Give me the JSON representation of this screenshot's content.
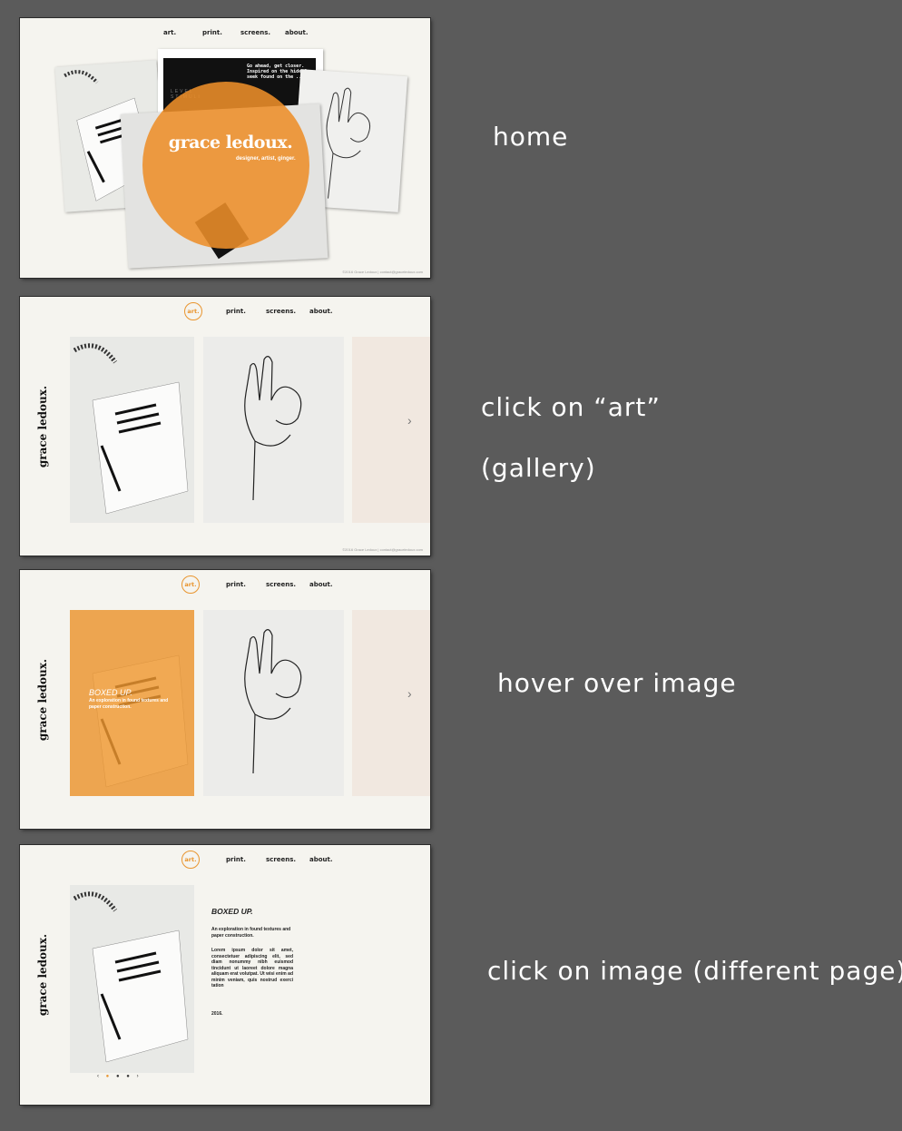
{
  "nav": {
    "art": "art.",
    "print": "print.",
    "screens": "screens.",
    "about": "about."
  },
  "site": {
    "brand": "grace ledoux.",
    "tagline": "designer, artist, ginger.",
    "footer": "©2016 Grace Ledoux | contact@graceledoux.com"
  },
  "home": {
    "card_text": "Go ahead, get closer. Inspired on the hide & seek found on the ...",
    "card_badge": "LEVEL STIMULI"
  },
  "annotations": {
    "home": "home",
    "art_click_1": "click on “art”",
    "art_click_2": "(gallery)",
    "hover": "hover over image",
    "detail": "click on image (different page)"
  },
  "gallery": {
    "next_icon": "›"
  },
  "hover_overlay": {
    "title": "BOXED UP.",
    "subtitle": "An exploration in found textures and paper construction."
  },
  "detail": {
    "title": "BOXED UP.",
    "subtitle": "An exploration in found textures and paper construction.",
    "body": "Lorem ipsum dolor sit amet, consectetuer adipiscing elit, sed diam nonummy nibh euismod tincidunt ut laoreet dolore magna aliquam erat volutpat. Ut wisi enim ad minim veniam, quis nostrud exerci tation",
    "year": "2016.",
    "pager_prev": "‹",
    "pager_next": "›"
  },
  "colors": {
    "accent": "#e9952f",
    "background": "#5b5b5b",
    "page": "#f5f4ef"
  }
}
